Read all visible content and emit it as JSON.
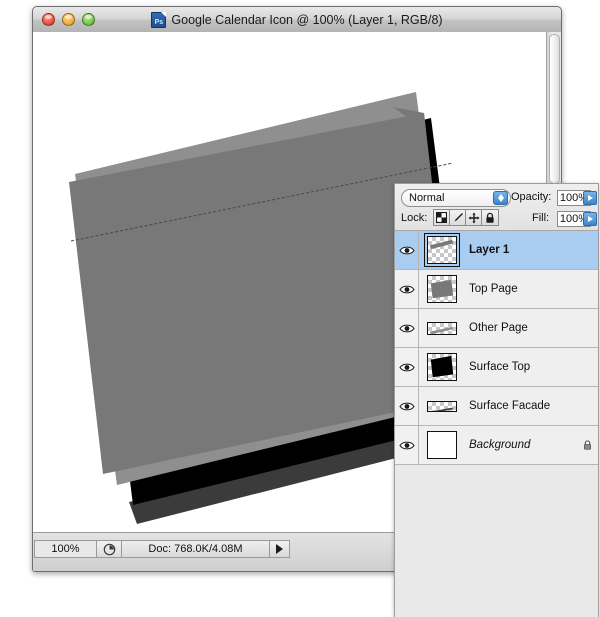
{
  "window": {
    "title": "Google Calendar Icon @ 100% (Layer 1, RGB/8)",
    "app_icon": "photoshop-document-icon",
    "app_icon_text": "Ps",
    "traffic_lights": {
      "close": "close-button",
      "minimize": "minimize-button",
      "zoom": "zoom-button"
    }
  },
  "statusbar": {
    "zoom_level": "100%",
    "doc_info": "Doc: 768.0K/4.08M",
    "size_icon": "document-size-icon",
    "arrow_icon": "status-arrow-icon"
  },
  "layers_panel": {
    "blend_mode": "Normal",
    "opacity_label": "Opacity:",
    "opacity_value": "100%",
    "fill_label": "Fill:",
    "fill_value": "100%",
    "lock_label": "Lock:",
    "lock_buttons": [
      {
        "name": "lock-transparent-pixels",
        "icon": "checkerboard-icon"
      },
      {
        "name": "lock-image-pixels",
        "icon": "brush-icon"
      },
      {
        "name": "lock-position",
        "icon": "move-icon"
      },
      {
        "name": "lock-all",
        "icon": "padlock-icon"
      }
    ],
    "layers": [
      {
        "name": "Layer 1",
        "visible": true,
        "selected": true,
        "italic": false,
        "locked": false,
        "thumb": "diagonal-strip"
      },
      {
        "name": "Top Page",
        "visible": true,
        "selected": false,
        "italic": false,
        "locked": false,
        "thumb": "gray-page"
      },
      {
        "name": "Other Page",
        "visible": true,
        "selected": false,
        "italic": false,
        "locked": false,
        "thumb": "thin-strip"
      },
      {
        "name": "Surface Top",
        "visible": true,
        "selected": false,
        "italic": false,
        "locked": false,
        "thumb": "black-page"
      },
      {
        "name": "Surface Facade",
        "visible": true,
        "selected": false,
        "italic": false,
        "locked": false,
        "thumb": "thin-strip"
      },
      {
        "name": "Background",
        "visible": true,
        "selected": false,
        "italic": true,
        "locked": true,
        "thumb": "white-solid"
      }
    ]
  },
  "colors": {
    "selection_blue": "#a8cdf0",
    "artwork_gray": "#787878",
    "artwork_light_gray": "#8f8f8f",
    "artwork_black": "#000000",
    "artwork_dark_gray": "#3b3b3b",
    "panel_bg": "#ebebeb"
  }
}
